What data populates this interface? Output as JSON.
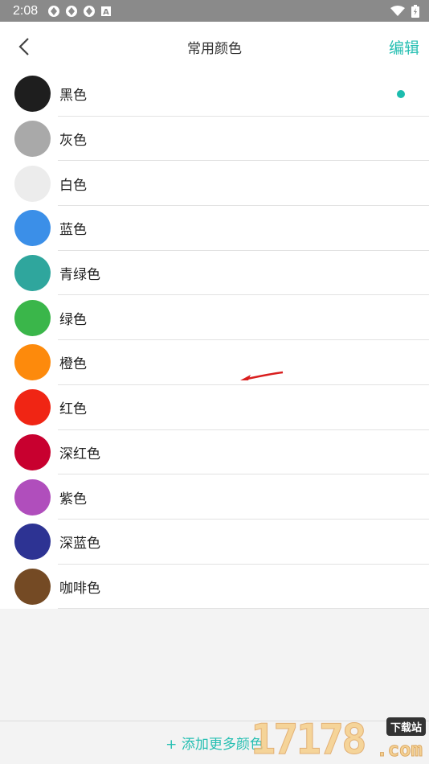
{
  "status_bar": {
    "time": "2:08",
    "icons": [
      "settings-icon",
      "settings-icon",
      "settings-icon",
      "a-icon"
    ],
    "right_icons": [
      "wifi-icon",
      "battery-icon"
    ]
  },
  "header": {
    "back_icon": "chevron-left-icon",
    "title": "常用颜色",
    "edit_label": "编辑"
  },
  "colors": [
    {
      "name": "黑色",
      "color": "#1e1e1e",
      "selected": true
    },
    {
      "name": "灰色",
      "color": "#a9a9a9",
      "selected": false
    },
    {
      "name": "白色",
      "color": "#ececec",
      "selected": false
    },
    {
      "name": "蓝色",
      "color": "#3b8fe8",
      "selected": false
    },
    {
      "name": "青绿色",
      "color": "#2fa69d",
      "selected": false
    },
    {
      "name": "绿色",
      "color": "#3ab64a",
      "selected": false
    },
    {
      "name": "橙色",
      "color": "#fd8a0c",
      "selected": false
    },
    {
      "name": "红色",
      "color": "#f02514",
      "selected": false
    },
    {
      "name": "深红色",
      "color": "#c8002f",
      "selected": false
    },
    {
      "name": "紫色",
      "color": "#b04ebc",
      "selected": false
    },
    {
      "name": "深蓝色",
      "color": "#2d3393",
      "selected": false
    },
    {
      "name": "咖啡色",
      "color": "#744a24",
      "selected": false
    }
  ],
  "footer": {
    "add_more_label": "+ 添加更多颜色"
  },
  "watermark": {
    "number": "17178",
    "badge": "下载站",
    "domain": ".com"
  },
  "accent_color": "#26bfb2"
}
